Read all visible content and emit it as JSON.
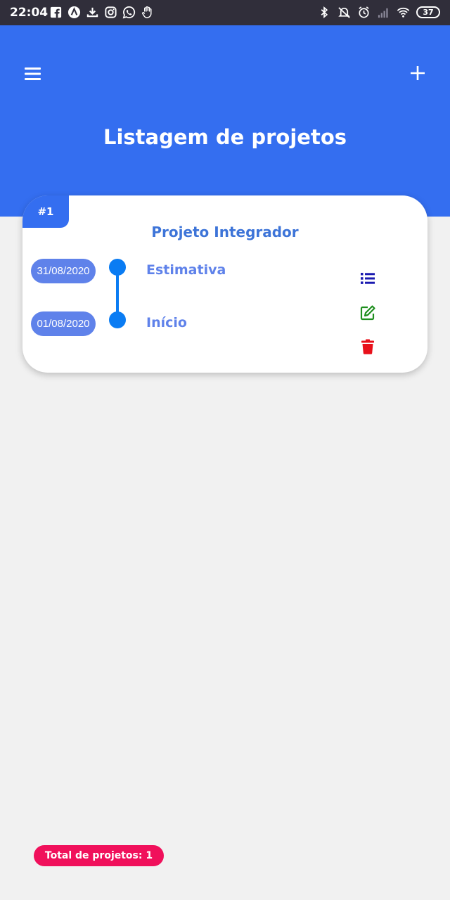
{
  "status_bar": {
    "time": "22:04",
    "battery": "37",
    "left_icons": [
      "facebook-icon",
      "nav-icon",
      "download-icon",
      "instagram-icon",
      "whatsapp-icon",
      "hand-icon"
    ],
    "right_icons": [
      "bluetooth-icon",
      "mute-icon",
      "alarm-icon",
      "signal-icon",
      "wifi-icon"
    ]
  },
  "header": {
    "title": "Listagem de projetos",
    "color": "#346ef0"
  },
  "project_card": {
    "number": "#1",
    "title": "Projeto Integrador",
    "timeline": [
      {
        "date": "31/08/2020",
        "label": "Estimativa"
      },
      {
        "date": "01/08/2020",
        "label": "Início"
      }
    ],
    "actions": {
      "list_color": "#1a1ab0",
      "edit_color": "#1f8f1f",
      "delete_color": "#e8101a"
    }
  },
  "footer": {
    "total_label": "Total de projetos: 1",
    "color": "#f0105b"
  }
}
